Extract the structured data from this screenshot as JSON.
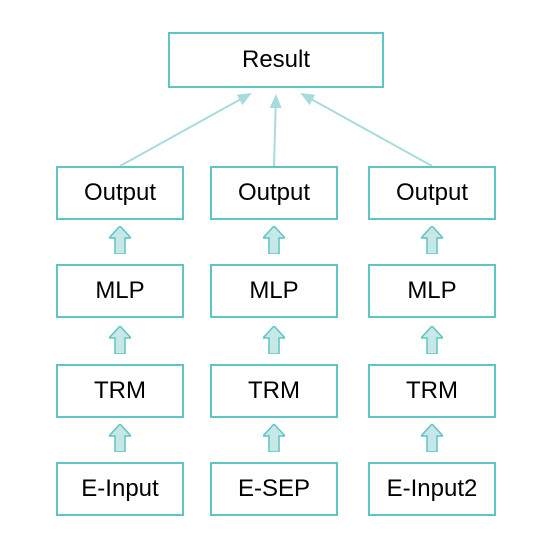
{
  "diagram": {
    "result": "Result",
    "columns": [
      {
        "output": "Output",
        "mlp": "MLP",
        "trm": "TRM",
        "input": "E-Input"
      },
      {
        "output": "Output",
        "mlp": "MLP",
        "trm": "TRM",
        "input": "E-SEP"
      },
      {
        "output": "Output",
        "mlp": "MLP",
        "trm": "TRM",
        "input": "E-Input2"
      }
    ],
    "colors": {
      "border": "#5ec4c4",
      "arrow_fill": "#c8e8e8",
      "arrow_stroke": "#5ec4c4",
      "converge_stroke": "#a8dcdc"
    }
  }
}
